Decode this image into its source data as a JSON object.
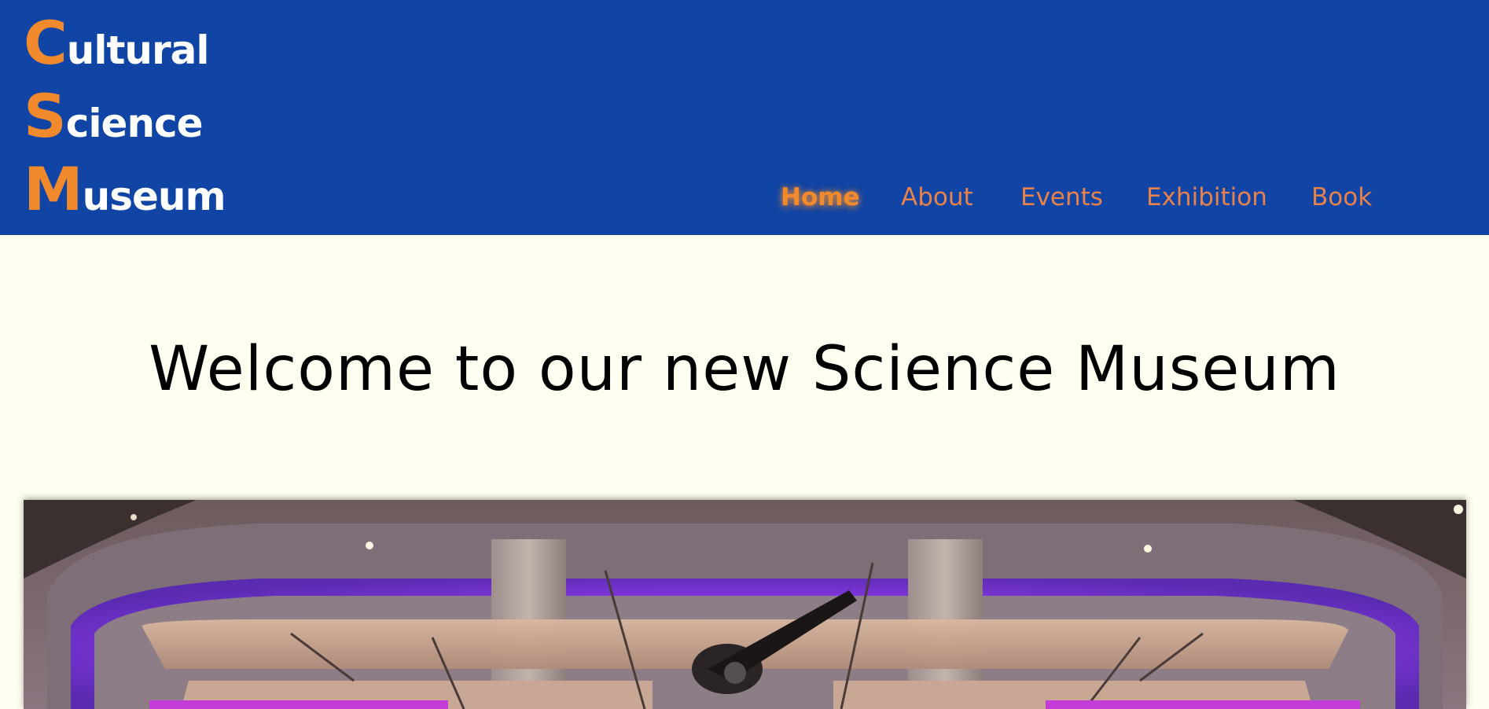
{
  "logo": {
    "lines": [
      {
        "initial": "C",
        "rest": "ultural"
      },
      {
        "initial": "S",
        "rest": "cience"
      },
      {
        "initial": "M",
        "rest": "useum"
      }
    ]
  },
  "nav": {
    "items": [
      {
        "label": "Home",
        "active": true
      },
      {
        "label": "About",
        "active": false
      },
      {
        "label": "Events",
        "active": false
      },
      {
        "label": "Exhibition",
        "active": false
      },
      {
        "label": "Book",
        "active": false
      }
    ]
  },
  "main": {
    "heading": "Welcome to our new Science Museum"
  },
  "colors": {
    "header_bg": "#1045a6",
    "accent": "#f08a2c",
    "page_bg": "#fefff0"
  }
}
